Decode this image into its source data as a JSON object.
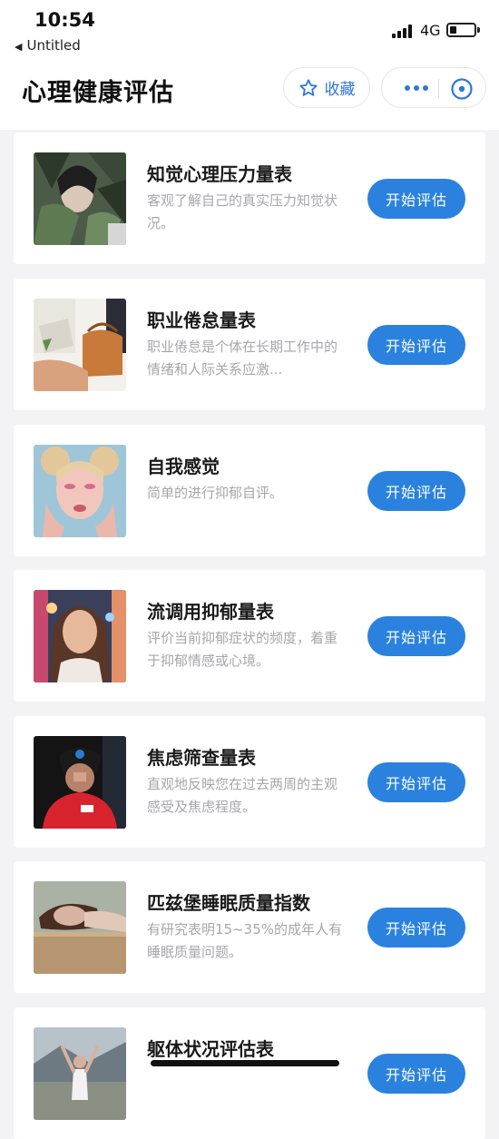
{
  "status_bar": {
    "time": "10:54",
    "back_app": "Untitled",
    "network": "4G"
  },
  "header": {
    "title": "心理健康评估",
    "favorite_label": "收藏",
    "more_icon": "ellipsis-icon",
    "close_icon": "target-close-icon"
  },
  "colors": {
    "accent": "#2a82de",
    "link": "#2f78d6",
    "background": "#f3f3f5",
    "card": "#ffffff",
    "desc_text": "#a7a7ab"
  },
  "assessments": [
    {
      "title": "知觉心理压力量表",
      "description": "客观了解自己的真实压力知觉状况。",
      "button": "开始评估",
      "image": "woman-with-plants-photo"
    },
    {
      "title": "职业倦怠量表",
      "description": "职业倦怠是个体在长期工作中的情绪和人际关系应激...",
      "button": "开始评估",
      "image": "laptop-and-bag-photo"
    },
    {
      "title": "自我感觉",
      "description": "简单的进行抑郁自评。",
      "button": "开始评估",
      "image": "woman-hands-on-face-photo"
    },
    {
      "title": "流调用抑郁量表",
      "description": "评价当前抑郁症状的频度，着重于抑郁情感或心境。",
      "button": "开始评估",
      "image": "woman-portrait-photo"
    },
    {
      "title": "焦虑筛查量表",
      "description": "直观地反映您在过去两周的主观感受及焦虑程度。",
      "button": "开始评估",
      "image": "man-red-hoodie-photo"
    },
    {
      "title": "匹兹堡睡眠质量指数",
      "description": "有研究表明15~35%的成年人有睡眠质量问题。",
      "button": "开始评估",
      "image": "woman-sleeping-photo"
    },
    {
      "title": "躯体状况评估表",
      "description": "",
      "button": "开始评估",
      "image": "person-arms-raised-photo"
    }
  ]
}
